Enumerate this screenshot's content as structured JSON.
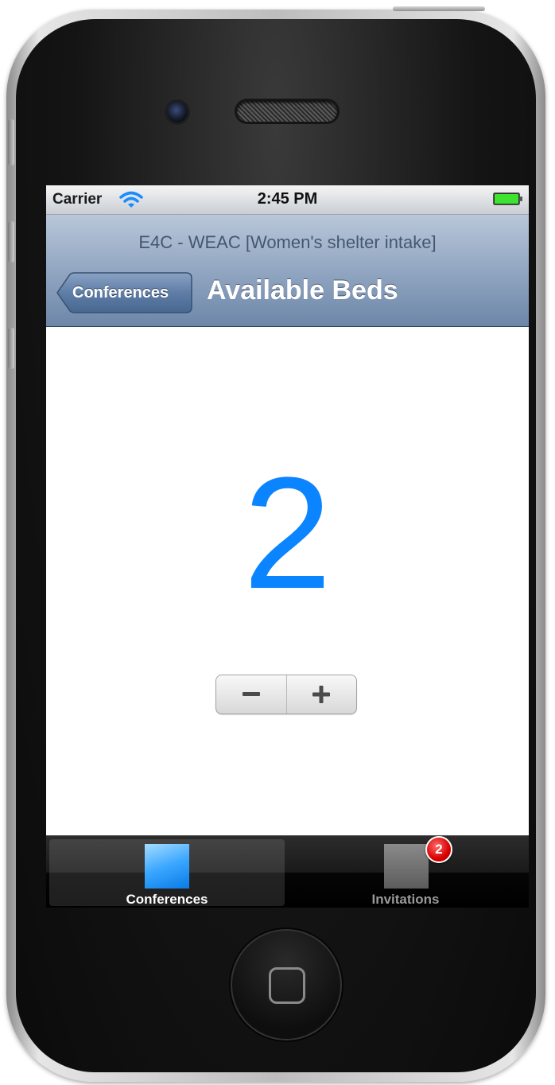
{
  "status_bar": {
    "carrier": "Carrier",
    "time": "2:45 PM",
    "wifi_icon": "wifi-icon",
    "battery_icon": "battery-icon"
  },
  "nav_bar": {
    "prompt": "E4C - WEAC [Women's shelter intake]",
    "back_label": "Conferences",
    "title": "Available Beds"
  },
  "content": {
    "count": "2",
    "count_color": "#0a84ff",
    "stepper": {
      "decrement_icon": "minus-icon",
      "increment_icon": "plus-icon"
    }
  },
  "tab_bar": {
    "tabs": [
      {
        "label": "Conferences",
        "icon": "conferences-tab-icon",
        "selected": true
      },
      {
        "label": "Invitations",
        "icon": "invitations-tab-icon",
        "selected": false,
        "badge": "2"
      }
    ]
  },
  "colors": {
    "nav_bar": "#8ea3bf",
    "badge": "#d80000",
    "tab_selected_icon": "#3aa7ff"
  }
}
